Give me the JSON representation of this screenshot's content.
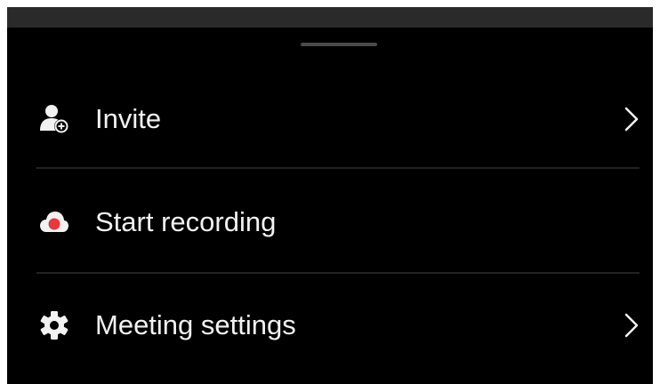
{
  "menu": {
    "items": [
      {
        "label": "Invite",
        "icon": "add-person-icon",
        "has_chevron": true
      },
      {
        "label": "Start recording",
        "icon": "record-cloud-icon",
        "has_chevron": false
      },
      {
        "label": "Meeting settings",
        "icon": "gear-icon",
        "has_chevron": true
      }
    ]
  },
  "colors": {
    "background": "#000000",
    "text": "#f2f2f2",
    "record_accent": "#e8383b",
    "divider": "#222222"
  }
}
